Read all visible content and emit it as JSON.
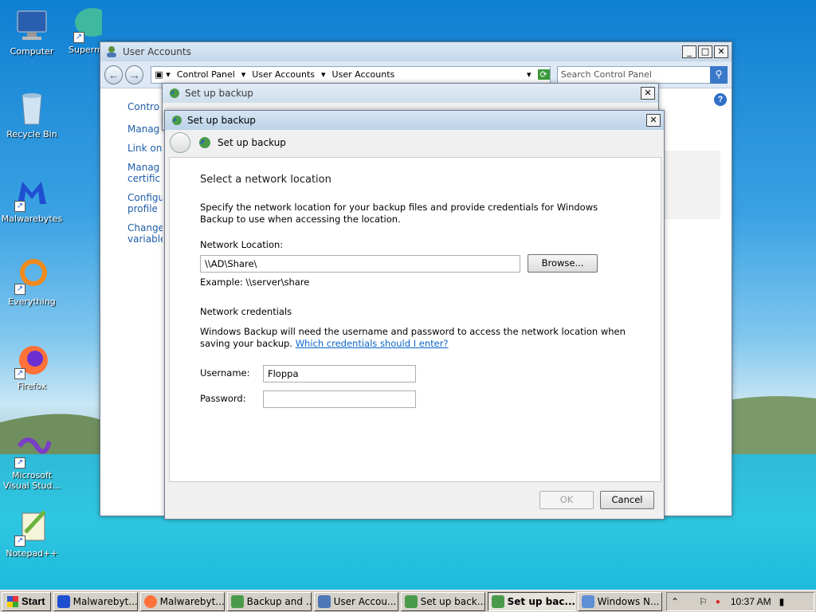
{
  "desktop": {
    "icons": [
      {
        "label": "Computer"
      },
      {
        "label": "Superm"
      },
      {
        "label": "Recycle Bin"
      },
      {
        "label": "Malwarebytes"
      },
      {
        "label": "Everything"
      },
      {
        "label": "Firefox"
      },
      {
        "label": "Microsoft Visual Stud..."
      },
      {
        "label": "Notepad++"
      }
    ]
  },
  "user_accounts": {
    "title": "User Accounts",
    "breadcrumb": [
      "Control Panel",
      "User Accounts",
      "User Accounts"
    ],
    "search_placeholder": "Search Control Panel",
    "side_links": [
      "Contro",
      "Manag",
      "Link on",
      "Manag certific",
      "Configu profile",
      "Change variable"
    ]
  },
  "backup_back": {
    "title": "Set up backup"
  },
  "backup_dialog": {
    "title": "Set up backup",
    "header": "Set up backup",
    "heading": "Select a network location",
    "description": "Specify the network location for your backup files and provide credentials for Windows Backup to use when accessing the location.",
    "location_label": "Network Location:",
    "location_value": "\\\\AD\\Share\\",
    "browse_label": "Browse...",
    "example": "Example: \\\\server\\share",
    "credentials_heading": "Network credentials",
    "credentials_text": "Windows Backup will need the username and password to access the network location when saving your backup.",
    "credentials_link": "Which credentials should I enter?",
    "username_label": "Username:",
    "username_value": "Floppa",
    "password_label": "Password:",
    "password_value": "",
    "ok_label": "OK",
    "cancel_label": "Cancel"
  },
  "taskbar": {
    "start_label": "Start",
    "tasks": [
      "Malwarebyt...",
      "Malwarebyt...",
      "Backup and ...",
      "User Accou...",
      "Set up back...",
      "Set up bac...",
      "Windows N..."
    ],
    "active_task_index": 5,
    "clock": "10:37 AM"
  }
}
